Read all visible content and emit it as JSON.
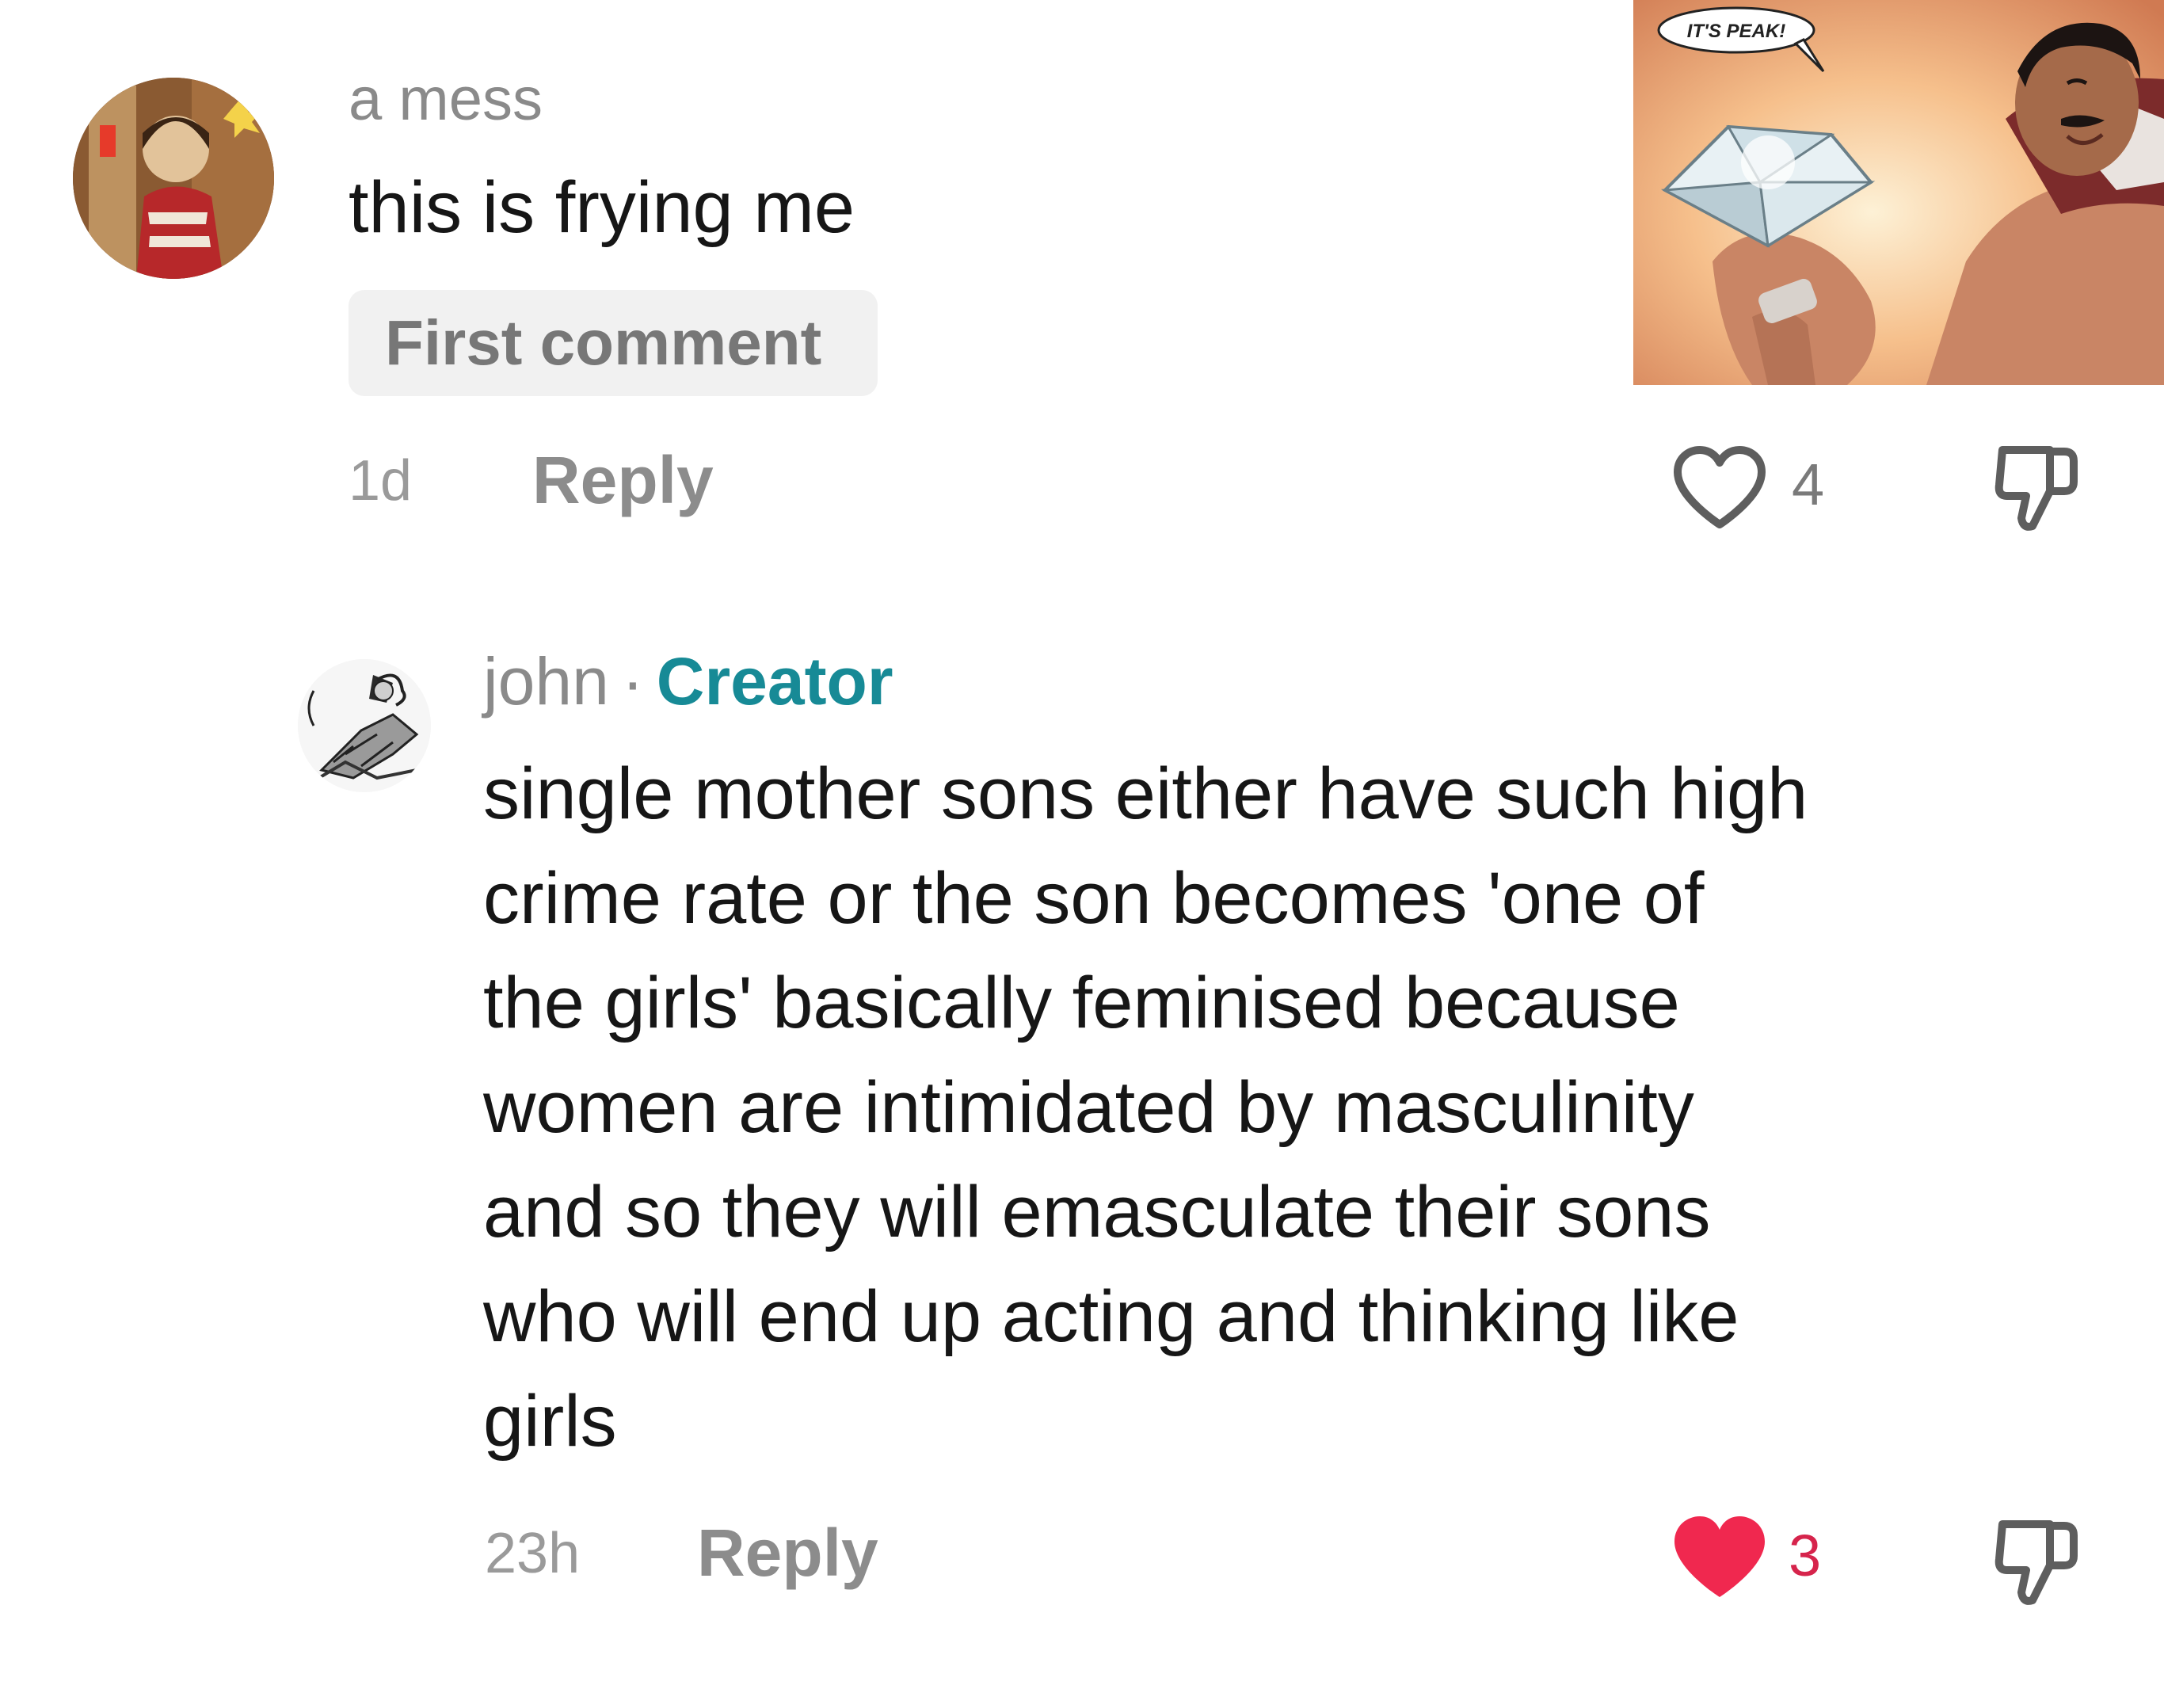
{
  "comments": [
    {
      "author": "a mess",
      "text": "this is frying me",
      "badge": "First comment",
      "time": "1d",
      "reply_label": "Reply",
      "likes": "4",
      "liked": false,
      "avatar": "profile-photo",
      "attached_image": {
        "icon": "peak-diamond-meme",
        "speech_bubble": "IT'S PEAK!"
      }
    },
    {
      "author": "john",
      "separator": "·",
      "role": "Creator",
      "text_lines": [
        "single mother sons either have such high",
        "crime rate or the son becomes 'one of",
        "the girls' basically feminised because",
        "women are intimidated by masculinity",
        "and so they will emasculate their sons",
        "who will end up acting and thinking like",
        "girls"
      ],
      "time": "23h",
      "reply_label": "Reply",
      "likes": "3",
      "liked": true,
      "avatar": "manga-sketch-avatar"
    }
  ],
  "colors": {
    "creator": "#178a96",
    "liked_heart": "#f0284f",
    "liked_count": "#d6244c",
    "muted_text": "#8a8a8a",
    "badge_bg": "#f1f1f1"
  }
}
